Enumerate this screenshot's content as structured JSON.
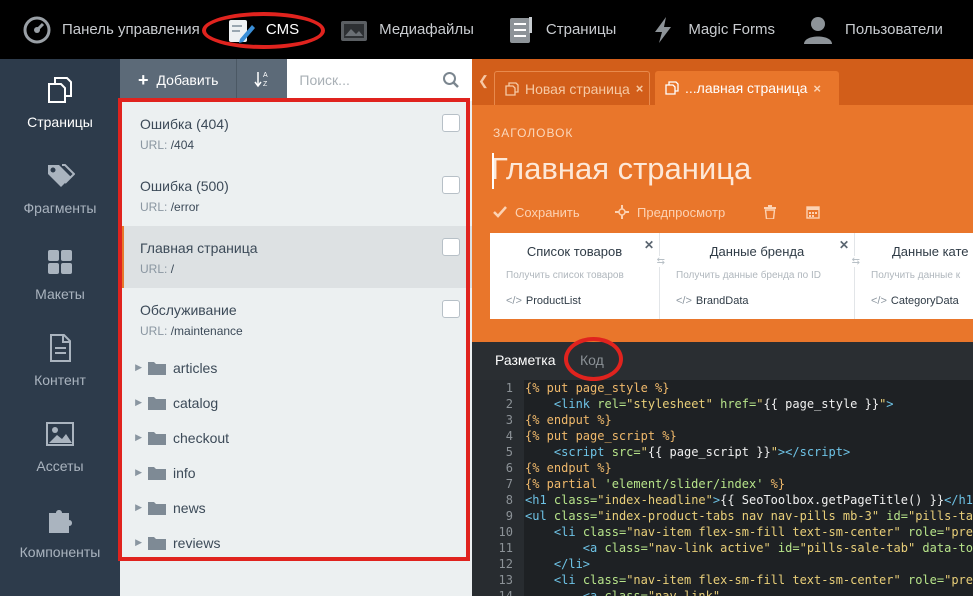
{
  "topbar": {
    "items": [
      {
        "label": "Панель управления",
        "icon": "dashboard-gauge-icon"
      },
      {
        "label": "CMS",
        "icon": "cms-pencil-icon",
        "active": true
      },
      {
        "label": "Медиафайлы",
        "icon": "media-photo-icon"
      },
      {
        "label": "Страницы",
        "icon": "pages-checklist-icon"
      },
      {
        "label": "Magic Forms",
        "icon": "lightning-icon"
      },
      {
        "label": "Пользователи",
        "icon": "user-icon"
      }
    ]
  },
  "leftnav": {
    "items": [
      {
        "label": "Страницы",
        "icon": "pages-icon",
        "active": true
      },
      {
        "label": "Фрагменты",
        "icon": "tags-icon"
      },
      {
        "label": "Макеты",
        "icon": "layouts-grid-icon"
      },
      {
        "label": "Контент",
        "icon": "content-document-icon"
      },
      {
        "label": "Ассеты",
        "icon": "assets-image-icon"
      },
      {
        "label": "Компоненты",
        "icon": "components-puzzle-icon"
      }
    ]
  },
  "list": {
    "add_label": "Добавить",
    "sort_label": "↓A-Z",
    "search_placeholder": "Поиск...",
    "url_prefix": "URL:",
    "pages": [
      {
        "title": "Ошибка (404)",
        "url": "/404"
      },
      {
        "title": "Ошибка (500)",
        "url": "/error"
      },
      {
        "title": "Главная страница",
        "url": "/",
        "active": true
      },
      {
        "title": "Обслуживание",
        "url": "/maintenance"
      }
    ],
    "folders": [
      "articles",
      "catalog",
      "checkout",
      "info",
      "news",
      "reviews"
    ]
  },
  "editor": {
    "tabs": [
      {
        "label": "Новая страница",
        "active": false
      },
      {
        "label": "...лавная страница",
        "active": true
      }
    ],
    "heading_label": "ЗАГОЛОВОК",
    "title_value": "Главная страница",
    "actions": {
      "save": "Сохранить",
      "preview": "Предпросмотр"
    },
    "components": [
      {
        "title": "Список товаров",
        "description": "Получить список товаров",
        "code": "ProductList"
      },
      {
        "title": "Данные бренда",
        "description": "Получить данные бренда по ID",
        "code": "BrandData"
      },
      {
        "title": "Данные кате",
        "description": "Получить данные к",
        "code": "CategoryData"
      }
    ],
    "code_tabs": {
      "markup": "Разметка",
      "code": "Код"
    },
    "code_lines": [
      "1",
      "2",
      "3",
      "4",
      "5",
      "6",
      "7",
      "8",
      "9",
      "10",
      "11",
      "12",
      "13",
      "14"
    ]
  },
  "colors": {
    "accent_orange": "#e9762b",
    "highlight_red": "#e0231e",
    "nav_bg": "#2d3b4b"
  }
}
